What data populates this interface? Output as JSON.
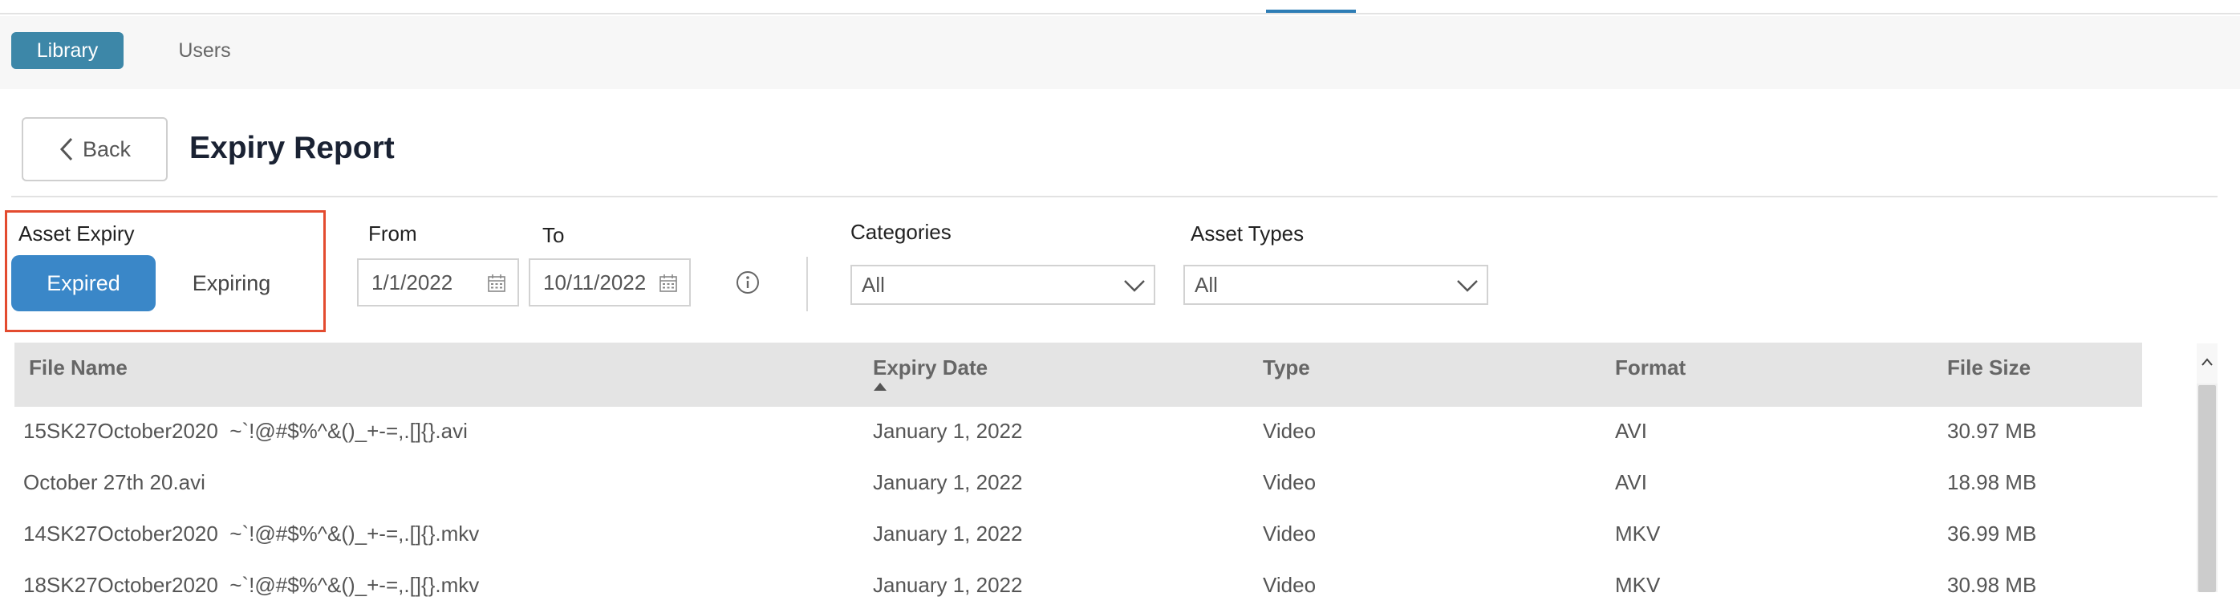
{
  "nav": {
    "library": "Library",
    "users": "Users"
  },
  "header": {
    "back_label": "Back",
    "title": "Expiry Report"
  },
  "filters": {
    "asset_expiry_label": "Asset Expiry",
    "expired_label": "Expired",
    "expiring_label": "Expiring",
    "selected_expiry": "Expired",
    "from_label": "From",
    "from_value": "1/1/2022",
    "to_label": "To",
    "to_value": "10/11/2022",
    "categories_label": "Categories",
    "categories_value": "All",
    "asset_types_label": "Asset Types",
    "asset_types_value": "All"
  },
  "table": {
    "columns": [
      "File Name",
      "Expiry Date",
      "Type",
      "Format",
      "File Size"
    ],
    "sort_column": "Expiry Date",
    "sort_direction": "ascending",
    "rows": [
      [
        "15SK27October2020  ~`!@#$%^&()_+-=,.[]{}.avi",
        "January 1, 2022",
        "Video",
        "AVI",
        "30.97 MB"
      ],
      [
        "October 27th 20.avi",
        "January 1, 2022",
        "Video",
        "AVI",
        "18.98 MB"
      ],
      [
        "14SK27October2020  ~`!@#$%^&()_+-=,.[]{}.mkv",
        "January 1, 2022",
        "Video",
        "MKV",
        "36.99 MB"
      ],
      [
        "18SK27October2020  ~`!@#$%^&()_+-=,.[]{}.mkv",
        "January 1, 2022",
        "Video",
        "MKV",
        "30.98 MB"
      ]
    ]
  },
  "colors": {
    "accent": "#3a87c8",
    "nav_active": "#3d87a8",
    "highlight_border": "#e34b2f"
  }
}
